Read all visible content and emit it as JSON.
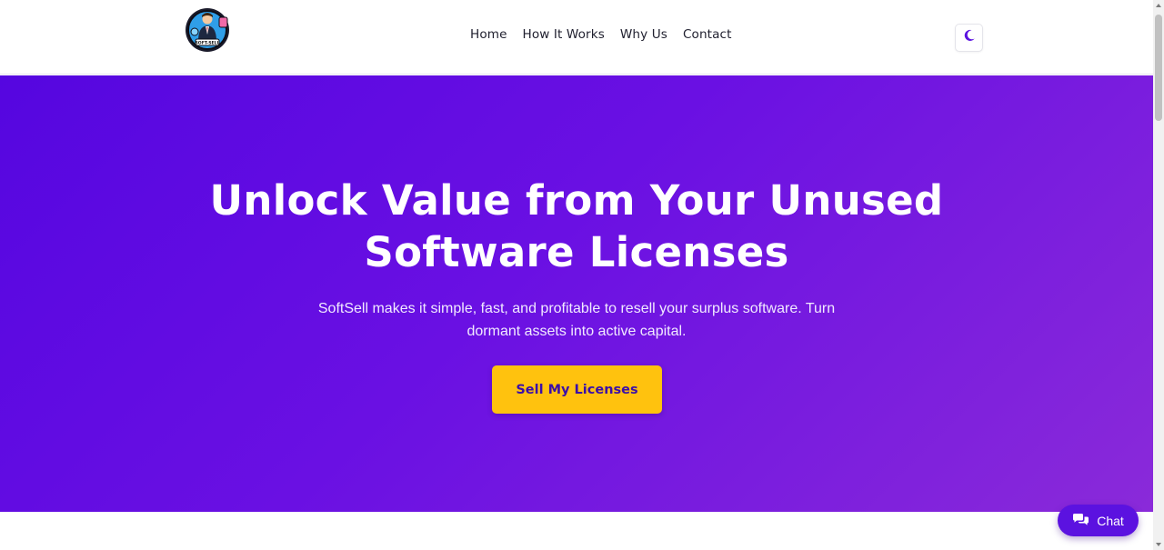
{
  "header": {
    "logo_text": "SOFT-SELL",
    "nav": [
      {
        "label": "Home"
      },
      {
        "label": "How It Works"
      },
      {
        "label": "Why Us"
      },
      {
        "label": "Contact"
      }
    ],
    "theme_toggle_icon": "moon-icon"
  },
  "hero": {
    "title_line1": "Unlock Value from Your Unused",
    "title_line2": "Software Licenses",
    "subtitle": "SoftSell makes it simple, fast, and profitable to resell your surplus software. Turn dormant assets into active capital.",
    "cta_label": "Sell My Licenses"
  },
  "chat": {
    "label": "Chat",
    "icon": "chat-bubbles-icon"
  },
  "colors": {
    "brand_purple": "#5b12e0",
    "hero_gradient_start": "#5506e0",
    "hero_gradient_end": "#8a2ad9",
    "cta_yellow": "#ffc20e"
  }
}
